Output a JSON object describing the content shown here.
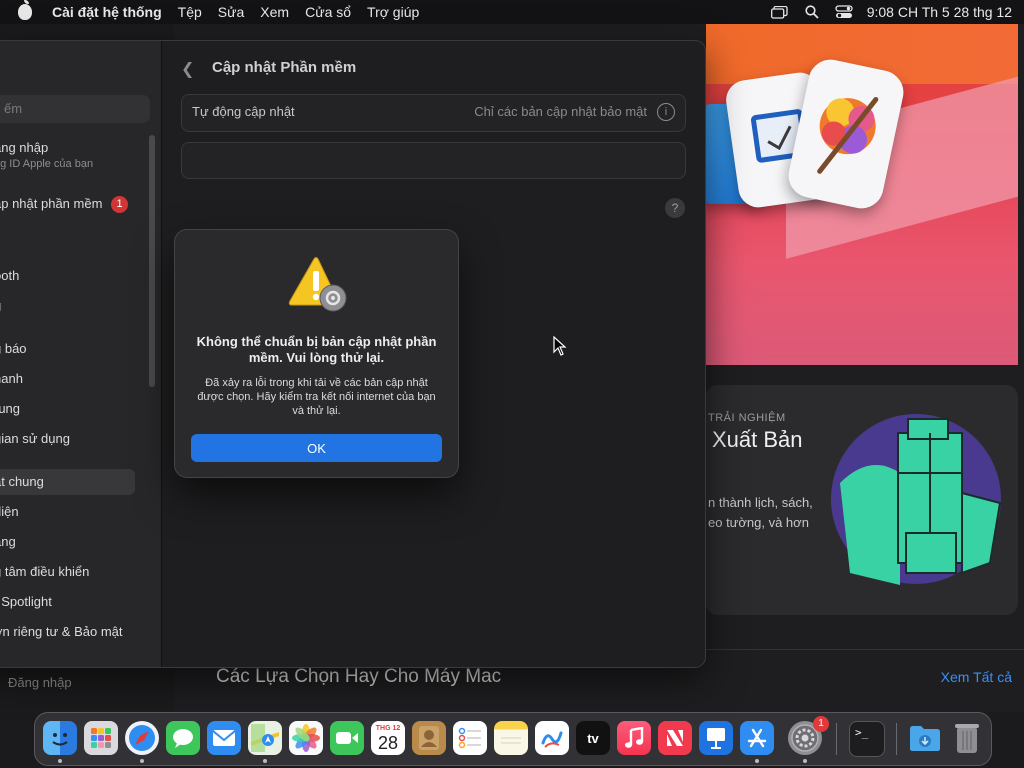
{
  "menubar": {
    "app_name": "Cài đặt hệ thống",
    "items": [
      "Tệp",
      "Sửa",
      "Xem",
      "Cửa sổ",
      "Trợ giúp"
    ],
    "clock": "9:08 CH Th 5 28 thg 12"
  },
  "store": {
    "card_label": "TRẢI NGHIỆM",
    "card_title": "Xuất Bản",
    "card_desc": "n thành lịch, sách, eo tường, và hơn",
    "section_title": "Các Lựa Chọn Hay Cho Máy Mac",
    "see_all": "Xem Tất cả"
  },
  "settings": {
    "pane_title": "Cập nhật Phần mềm",
    "auto_update_label": "Tự động cập nhật",
    "auto_update_value": "Chỉ các bản cập nhật bảo mật",
    "search_placeholder": "ếm",
    "sidebar": {
      "login": "ăng nhập",
      "login_sub": "ng ID Apple của bạn",
      "software_update": "ập nhật phần mềm",
      "software_update_badge": "1",
      "i": "i",
      "bluetooth": "ooth",
      "g": "g",
      "notifications": "g báo",
      "sound": "hanh",
      "focus": "rung",
      "screen_time": "gian sử dụng",
      "general": "ặt chung",
      "appearance": "diện",
      "accessibility": "ăng",
      "control_center": "g tâm điều khiển",
      "spotlight": "ı Spotlight",
      "privacy": "ơn riêng tư & Bảo mật",
      "bottom": "Đăng nhập"
    }
  },
  "alert": {
    "title": "Không thể chuẩn bị bản cập nhật phần mềm. Vui lòng thử lại.",
    "message": "Đã xảy ra lỗi trong khi tải về các bản cập nhật được chọn. Hãy kiểm tra kết nối internet của bạn và thử lại.",
    "ok": "OK"
  },
  "dock": {
    "calendar_month": "THG 12",
    "calendar_day": "28",
    "tv_label": "tv",
    "settings_badge": "1"
  }
}
